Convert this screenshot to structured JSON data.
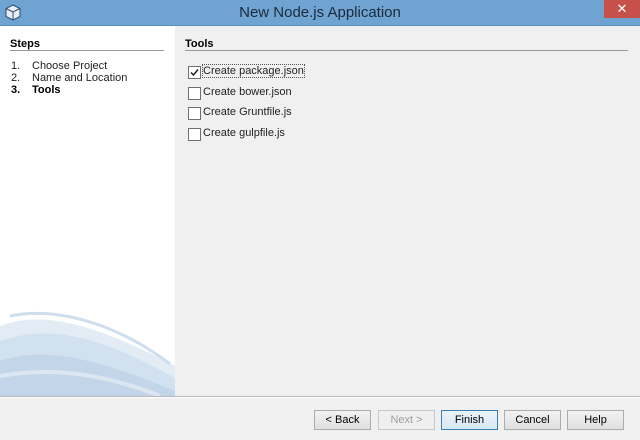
{
  "window": {
    "title": "New Node.js Application",
    "close_glyph": "✕",
    "app_icon": "netbeans-cube-icon"
  },
  "steps_panel": {
    "heading": "Steps",
    "items": [
      {
        "number": "1.",
        "label": "Choose Project",
        "current": false
      },
      {
        "number": "2.",
        "label": "Name and Location",
        "current": false
      },
      {
        "number": "3.",
        "label": "Tools",
        "current": true
      }
    ]
  },
  "tools_panel": {
    "heading": "Tools",
    "options": [
      {
        "label": "Create package.json",
        "checked": true
      },
      {
        "label": "Create bower.json",
        "checked": false
      },
      {
        "label": "Create Gruntfile.js",
        "checked": false
      },
      {
        "label": "Create gulpfile.js",
        "checked": false
      }
    ]
  },
  "buttons": {
    "back": "< Back",
    "next": "Next >",
    "finish": "Finish",
    "cancel": "Cancel",
    "help": "Help"
  },
  "colors": {
    "titlebar": "#6fa3d2",
    "close_button": "#c7504a",
    "steps_background": "#ffffff",
    "content_background": "#f0f0f0"
  }
}
